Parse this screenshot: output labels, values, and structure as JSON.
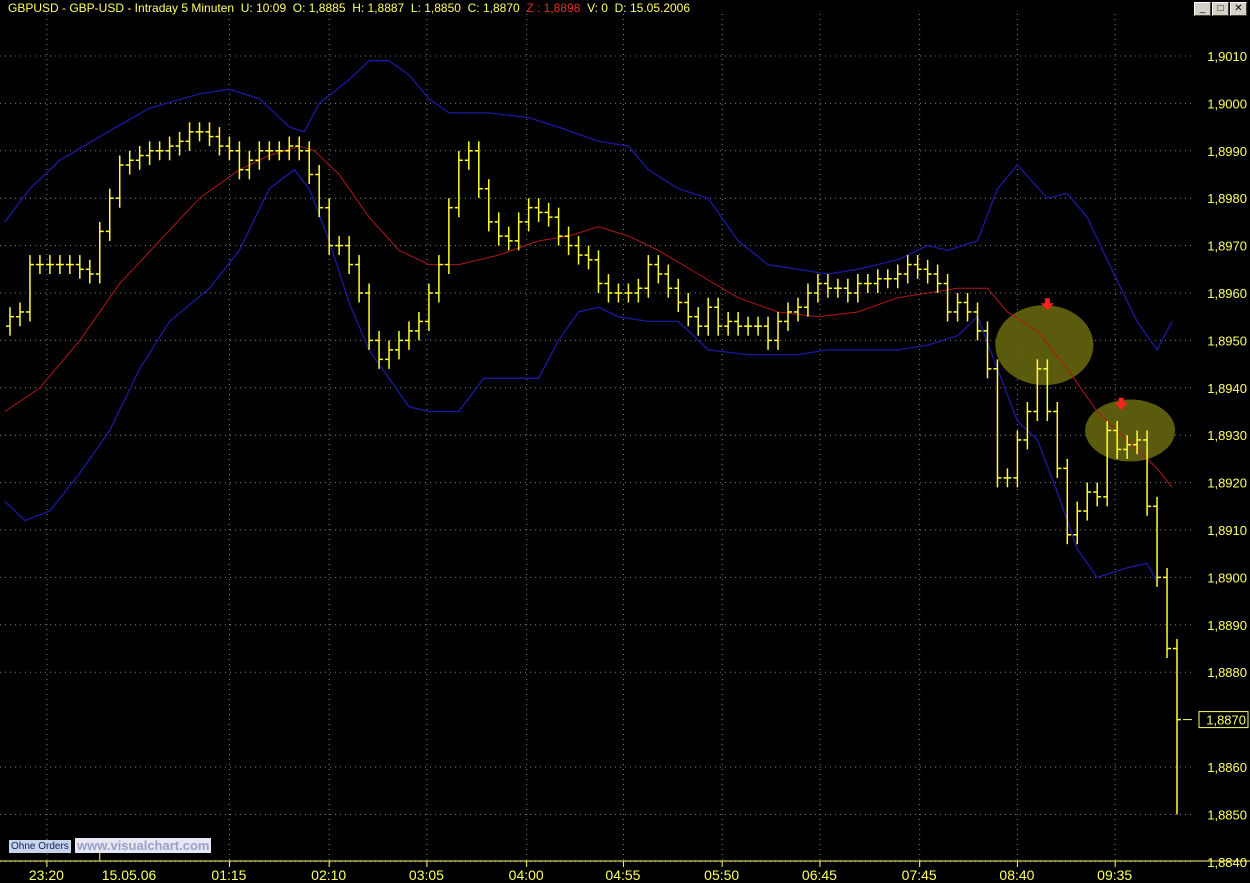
{
  "header": {
    "symbol": "GBPUSD - GBP-USD - Intraday 5 Minuten",
    "u": "U: 10:09",
    "o": "O: 1,8885",
    "h": "H: 1,8887",
    "l": "L: 1,8850",
    "c": "C: 1,8870",
    "z": "Z : 1,8898",
    "v": "V: 0",
    "d": "D: 15.05.2006"
  },
  "window_buttons": [
    "_",
    "□",
    "✕"
  ],
  "footer": {
    "orders": "Ohne Orders",
    "brand": "www.visualchart.com"
  },
  "colors": {
    "bars": "#ffff33",
    "bands": "#1a1aa0",
    "mid": "#b01818",
    "highlight": "#6b6b10",
    "arrow": "#ff2020"
  },
  "chart_data": {
    "type": "ohlc",
    "title": "GBPUSD - GBP-USD - Intraday 5 Minuten",
    "ylim": [
      1.884,
      1.9015
    ],
    "y_ticks": [
      "1,9010",
      "1,9000",
      "1,8990",
      "1,8980",
      "1,8970",
      "1,8960",
      "1,8950",
      "1,8940",
      "1,8930",
      "1,8920",
      "1,8910",
      "1,8900",
      "1,8890",
      "1,8880",
      "1,8860",
      "1,8850",
      "1,8840"
    ],
    "y_tick_values": [
      1.901,
      1.9,
      1.899,
      1.898,
      1.897,
      1.896,
      1.895,
      1.894,
      1.893,
      1.892,
      1.891,
      1.89,
      1.889,
      1.888,
      1.886,
      1.885,
      1.884
    ],
    "x_ticks": [
      {
        "label": "23:20",
        "idx": 3.7
      },
      {
        "label": "15.05.06",
        "idx": 9.0
      },
      {
        "label": "01:15",
        "idx": 22
      },
      {
        "label": "02:10",
        "idx": 32
      },
      {
        "label": "03:05",
        "idx": 41.8
      },
      {
        "label": "04:00",
        "idx": 51.8
      },
      {
        "label": "04:55",
        "idx": 61.5
      },
      {
        "label": "05:50",
        "idx": 71.4
      },
      {
        "label": "06:45",
        "idx": 81.2
      },
      {
        "label": "07:45",
        "idx": 91.2
      },
      {
        "label": "08:40",
        "idx": 101
      },
      {
        "label": "09:35",
        "idx": 110.8
      }
    ],
    "last_price": "1,8870",
    "last_price_value": 1.887,
    "last_bar": {
      "open": 1.8885,
      "high": 1.8887,
      "low": 1.885,
      "close": 1.887
    },
    "closes": [
      1.8955,
      1.8956,
      1.8966,
      1.8966,
      1.8966,
      1.8966,
      1.8966,
      1.8965,
      1.8964,
      1.8973,
      1.898,
      1.8987,
      1.8988,
      1.8989,
      1.899,
      1.899,
      1.8991,
      1.8992,
      1.8994,
      1.8994,
      1.8993,
      1.8991,
      1.899,
      1.8986,
      1.8988,
      1.899,
      1.899,
      1.899,
      1.8991,
      1.899,
      1.8985,
      1.8978,
      1.897,
      1.897,
      1.8966,
      1.896,
      1.895,
      1.8946,
      1.8948,
      1.895,
      1.8952,
      1.8954,
      1.896,
      1.8966,
      1.8978,
      1.8988,
      1.899,
      1.8982,
      1.8975,
      1.8972,
      1.8971,
      1.8975,
      1.8978,
      1.8977,
      1.8976,
      1.8972,
      1.897,
      1.8968,
      1.8967,
      1.8962,
      1.896,
      1.896,
      1.896,
      1.8961,
      1.8966,
      1.8964,
      1.8961,
      1.8958,
      1.8955,
      1.8953,
      1.8957,
      1.8953,
      1.8954,
      1.8953,
      1.8953,
      1.8953,
      1.895,
      1.8954,
      1.8956,
      1.8957,
      1.896,
      1.8962,
      1.8961,
      1.8961,
      1.896,
      1.8962,
      1.8962,
      1.8963,
      1.8963,
      1.8964,
      1.8966,
      1.8965,
      1.8964,
      1.8962,
      1.8956,
      1.8958,
      1.8956,
      1.8952,
      1.8944,
      1.8921,
      1.8921,
      1.8929,
      1.8935,
      1.8944,
      1.8935,
      1.8923,
      1.8909,
      1.8914,
      1.8918,
      1.8917,
      1.8931,
      1.8927,
      1.8928,
      1.8929,
      1.8915,
      1.89,
      1.8885,
      1.887
    ],
    "upper_band": [
      [
        -0.5,
        1.8975
      ],
      [
        2,
        1.8982
      ],
      [
        5,
        1.8988
      ],
      [
        9,
        1.8993
      ],
      [
        14,
        1.8999
      ],
      [
        19,
        1.9002
      ],
      [
        22,
        1.9003
      ],
      [
        25,
        1.9001
      ],
      [
        28,
        1.8995
      ],
      [
        29.5,
        1.8994
      ],
      [
        31,
        1.9
      ],
      [
        34,
        1.9005
      ],
      [
        36,
        1.9009
      ],
      [
        38,
        1.9009
      ],
      [
        40,
        1.9006
      ],
      [
        42,
        1.9001
      ],
      [
        44,
        1.8998
      ],
      [
        48,
        1.8998
      ],
      [
        52,
        1.8997
      ],
      [
        55,
        1.8995
      ],
      [
        59,
        1.8992
      ],
      [
        62,
        1.8991
      ],
      [
        64,
        1.8986
      ],
      [
        67,
        1.8982
      ],
      [
        70,
        1.898
      ],
      [
        73,
        1.8971
      ],
      [
        76,
        1.8966
      ],
      [
        79,
        1.8965
      ],
      [
        82,
        1.8964
      ],
      [
        85,
        1.8965
      ],
      [
        89,
        1.8967
      ],
      [
        92,
        1.897
      ],
      [
        94,
        1.8969
      ],
      [
        97,
        1.8971
      ],
      [
        99,
        1.8982
      ],
      [
        101,
        1.8987
      ],
      [
        104,
        1.898
      ],
      [
        106,
        1.8981
      ],
      [
        108,
        1.8976
      ],
      [
        110,
        1.8967
      ],
      [
        113,
        1.8954
      ],
      [
        115,
        1.8948
      ],
      [
        116.5,
        1.8954
      ]
    ],
    "lower_band": [
      [
        -0.5,
        1.8916
      ],
      [
        1.5,
        1.8912
      ],
      [
        4,
        1.8914
      ],
      [
        7,
        1.8922
      ],
      [
        10,
        1.8931
      ],
      [
        13,
        1.8944
      ],
      [
        16,
        1.8954
      ],
      [
        20,
        1.8961
      ],
      [
        23,
        1.8969
      ],
      [
        26,
        1.8982
      ],
      [
        28.5,
        1.8986
      ],
      [
        30,
        1.8982
      ],
      [
        32,
        1.8971
      ],
      [
        34,
        1.8958
      ],
      [
        36,
        1.8948
      ],
      [
        38,
        1.8942
      ],
      [
        40,
        1.8936
      ],
      [
        42,
        1.8935
      ],
      [
        45,
        1.8935
      ],
      [
        47.5,
        1.8942
      ],
      [
        53,
        1.8942
      ],
      [
        55,
        1.895
      ],
      [
        57,
        1.8956
      ],
      [
        59,
        1.8957
      ],
      [
        61,
        1.8955
      ],
      [
        64,
        1.8954
      ],
      [
        67,
        1.8954
      ],
      [
        70,
        1.8948
      ],
      [
        74,
        1.8947
      ],
      [
        79,
        1.8947
      ],
      [
        82,
        1.8948
      ],
      [
        85,
        1.8948
      ],
      [
        89,
        1.8948
      ],
      [
        92,
        1.8949
      ],
      [
        95,
        1.8951
      ],
      [
        97,
        1.8955
      ],
      [
        99,
        1.8944
      ],
      [
        101,
        1.8933
      ],
      [
        103,
        1.8929
      ],
      [
        105,
        1.8918
      ],
      [
        107,
        1.8906
      ],
      [
        109,
        1.89
      ],
      [
        112,
        1.8902
      ],
      [
        114,
        1.8903
      ],
      [
        115,
        1.8899
      ]
    ],
    "middle_line": [
      [
        -0.5,
        1.8935
      ],
      [
        3,
        1.894
      ],
      [
        7,
        1.895
      ],
      [
        11,
        1.8962
      ],
      [
        15,
        1.8971
      ],
      [
        19,
        1.898
      ],
      [
        23,
        1.8986
      ],
      [
        26,
        1.8989
      ],
      [
        29,
        1.8991
      ],
      [
        30.5,
        1.899
      ],
      [
        33,
        1.8985
      ],
      [
        36,
        1.8976
      ],
      [
        39,
        1.8969
      ],
      [
        42,
        1.8966
      ],
      [
        45,
        1.8966
      ],
      [
        49,
        1.8968
      ],
      [
        53,
        1.8971
      ],
      [
        56,
        1.8972
      ],
      [
        59,
        1.8974
      ],
      [
        62,
        1.8972
      ],
      [
        65,
        1.8969
      ],
      [
        69,
        1.8964
      ],
      [
        73,
        1.8959
      ],
      [
        77,
        1.8956
      ],
      [
        81,
        1.8955
      ],
      [
        85,
        1.8956
      ],
      [
        89,
        1.8959
      ],
      [
        92,
        1.896
      ],
      [
        95,
        1.8961
      ],
      [
        98,
        1.8961
      ],
      [
        100,
        1.8956
      ],
      [
        103,
        1.8952
      ],
      [
        106,
        1.8944
      ],
      [
        109,
        1.8935
      ],
      [
        112,
        1.8929
      ],
      [
        115,
        1.8923
      ],
      [
        116.5,
        1.8919
      ]
    ],
    "annotations": [
      {
        "type": "ellipse",
        "idx": 103.7,
        "price": 1.8949
      },
      {
        "type": "ellipse",
        "idx": 112.3,
        "price": 1.8931
      }
    ],
    "signals": [
      {
        "type": "arrow-down",
        "idx": 104,
        "price": 1.8957
      },
      {
        "type": "arrow-down",
        "idx": 111.4,
        "price": 1.8936
      }
    ]
  }
}
